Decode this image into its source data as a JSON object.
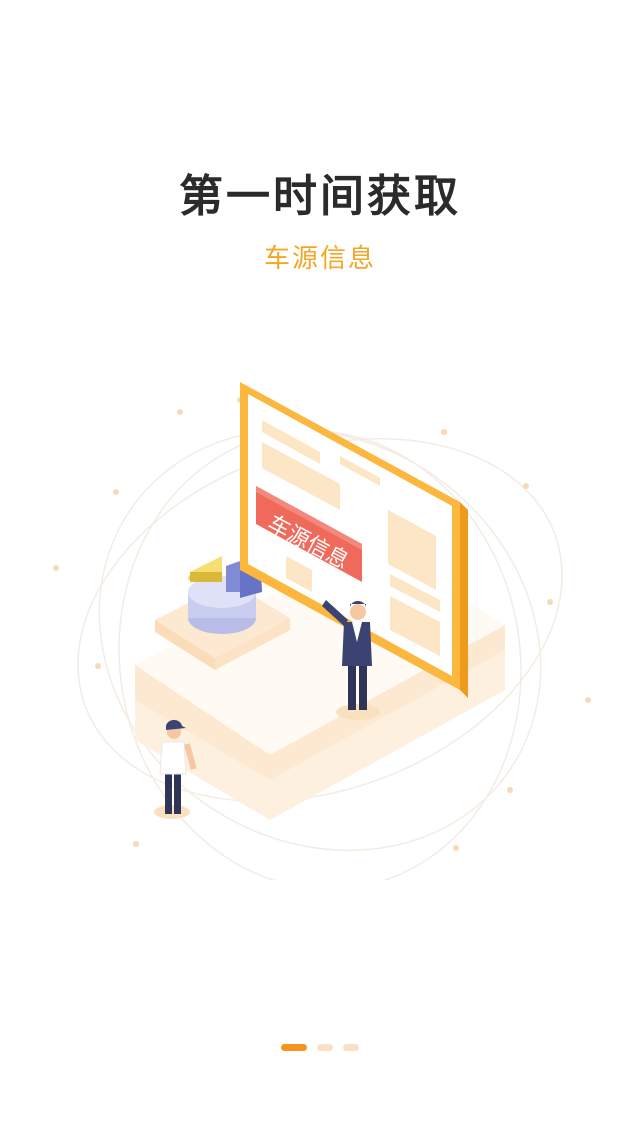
{
  "onboarding": {
    "title": "第一时间获取",
    "subtitle": "车源信息",
    "illustration": {
      "banner_label": "车源信息",
      "accent_color": "#f7941d",
      "frame_color": "#fbb73e",
      "banner_color": "#f06a5b"
    },
    "pager": {
      "total": 3,
      "active_index": 0
    }
  }
}
